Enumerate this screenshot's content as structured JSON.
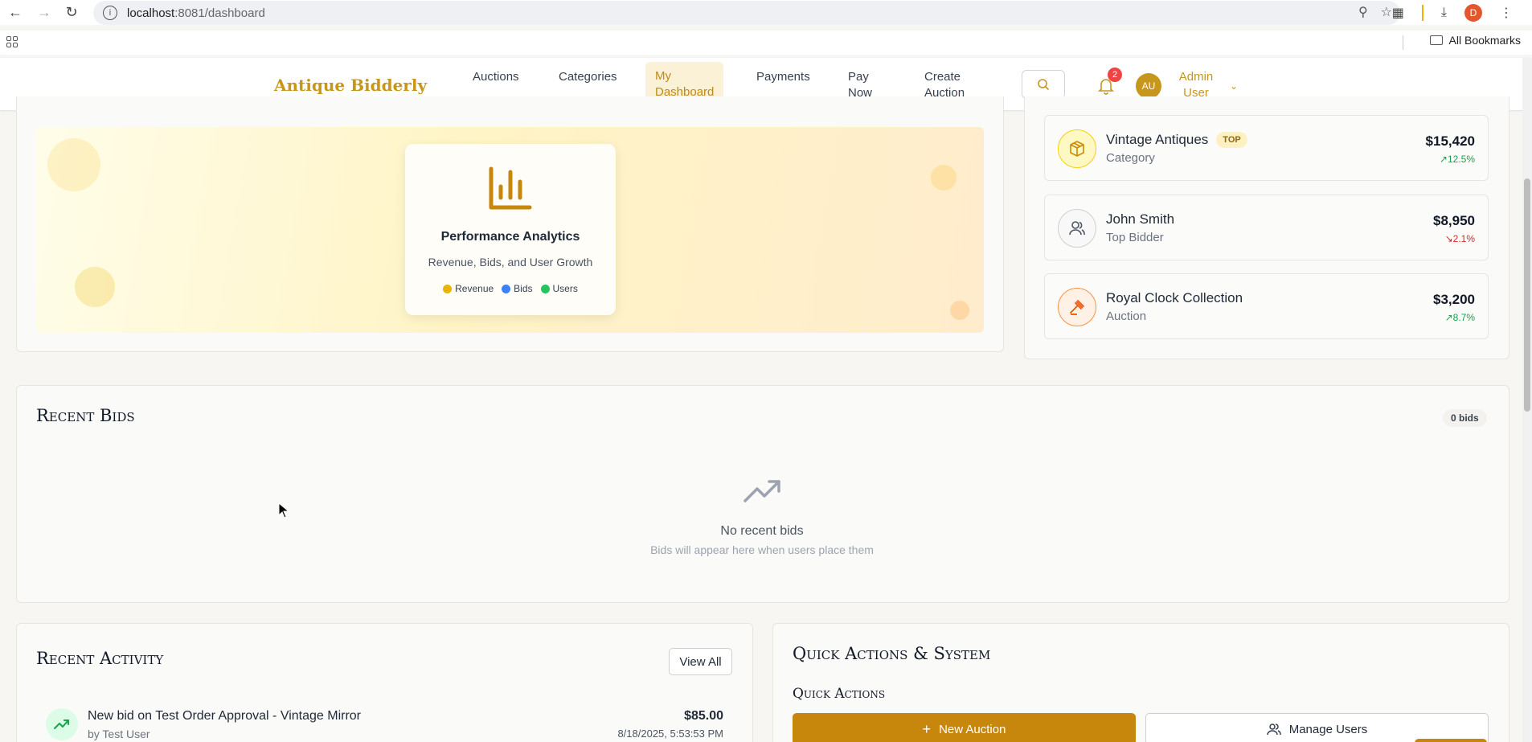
{
  "browser": {
    "url_host": "localhost",
    "url_path": ":8081/dashboard",
    "profile_initial": "D",
    "all_bookmarks": "All Bookmarks"
  },
  "nav": {
    "brand": "Antique Bidderly",
    "items": [
      {
        "label_line1": "Auctions",
        "label_line2": ""
      },
      {
        "label_line1": "Categories",
        "label_line2": ""
      },
      {
        "label_line1": "My",
        "label_line2": "Dashboard",
        "active": true
      },
      {
        "label_line1": "Payments",
        "label_line2": ""
      },
      {
        "label_line1": "Pay",
        "label_line2": "Now"
      },
      {
        "label_line1": "Create",
        "label_line2": "Auction"
      }
    ],
    "notification_count": "2",
    "avatar_initials": "AU",
    "user_line1": "Admin",
    "user_line2": "User"
  },
  "analytics": {
    "title": "Performance Analytics",
    "subtitle": "Revenue, Bids, and User Growth",
    "legend": [
      {
        "label": "Revenue",
        "color": "#eab308"
      },
      {
        "label": "Bids",
        "color": "#3b82f6"
      },
      {
        "label": "Users",
        "color": "#22c55e"
      }
    ]
  },
  "top_performers": [
    {
      "name": "Vintage Antiques",
      "badge": "TOP",
      "type": "Category",
      "amount": "$15,420",
      "change": "12.5%",
      "direction": "up",
      "icon": "package-icon"
    },
    {
      "name": "John Smith",
      "badge": "",
      "type": "Top Bidder",
      "amount": "$8,950",
      "change": "2.1%",
      "direction": "down",
      "icon": "users-icon"
    },
    {
      "name": "Royal Clock Collection",
      "badge": "",
      "type": "Auction",
      "amount": "$3,200",
      "change": "8.7%",
      "direction": "up",
      "icon": "gavel-icon"
    }
  ],
  "recent_bids": {
    "title": "Recent Bids",
    "count": "0 bids",
    "empty_title": "No recent bids",
    "empty_subtitle": "Bids will appear here when users place them"
  },
  "recent_activity": {
    "title": "Recent Activity",
    "view_all": "View All",
    "items": [
      {
        "title": "New bid on Test Order Approval - Vintage Mirror",
        "by": "by Test User",
        "amount": "$85.00",
        "time": "8/18/2025, 5:53:53 PM"
      }
    ]
  },
  "quick_actions": {
    "title": "Quick Actions & System",
    "subtitle": "Quick Actions",
    "new_auction": "New Auction",
    "manage_users": "Manage Users"
  },
  "colors": {
    "brand": "#c7971b",
    "primary_button": "#c7870c",
    "up": "#16a34a",
    "down": "#dc2626"
  }
}
